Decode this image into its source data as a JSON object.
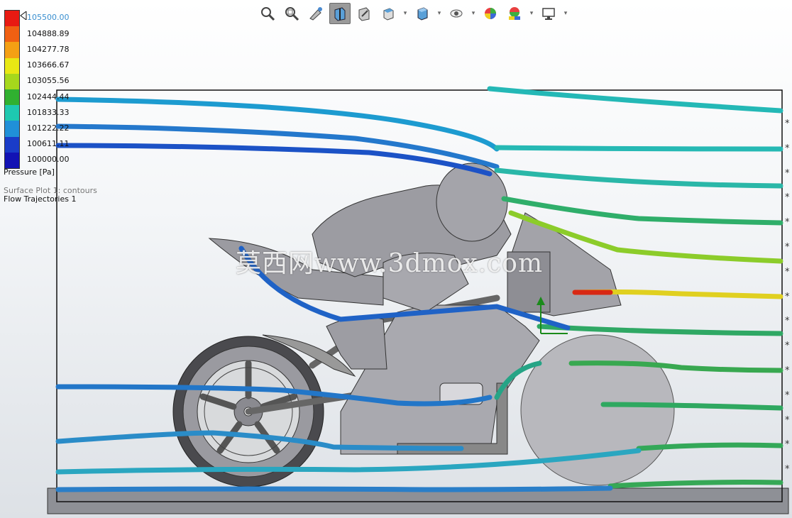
{
  "toolbar": {
    "icons": [
      "zoom-to-fit-icon",
      "zoom-to-area-icon",
      "previous-view-icon",
      "section-view-icon",
      "dynamic-annotation-icon",
      "view-orientation-icon",
      "display-style-icon",
      "hide-show-items-icon",
      "edit-appearance-icon",
      "apply-scene-icon",
      "view-settings-icon"
    ]
  },
  "legend": {
    "labels": [
      "105500.00",
      "104888.89",
      "104277.78",
      "103666.67",
      "103055.56",
      "102444.44",
      "101833.33",
      "101222.22",
      "100611.11",
      "100000.00"
    ],
    "colors": [
      "#e81a12",
      "#f06012",
      "#f4a014",
      "#e8e814",
      "#a6d81c",
      "#30b030",
      "#1ec8b0",
      "#2090d8",
      "#1a3cc8",
      "#1212b4"
    ],
    "title": "Pressure [Pa]"
  },
  "plot_info": {
    "surface_plot": "Surface Plot 1: contours",
    "flow_trajectories": "Flow Trajectories 1"
  },
  "watermark": "莫西网www.3dmox.com",
  "side_ticks": [
    "*",
    "*",
    "*",
    "*",
    "*",
    "*",
    "*",
    "*",
    "*",
    "*",
    "*",
    "*",
    "*",
    "*",
    "*"
  ]
}
